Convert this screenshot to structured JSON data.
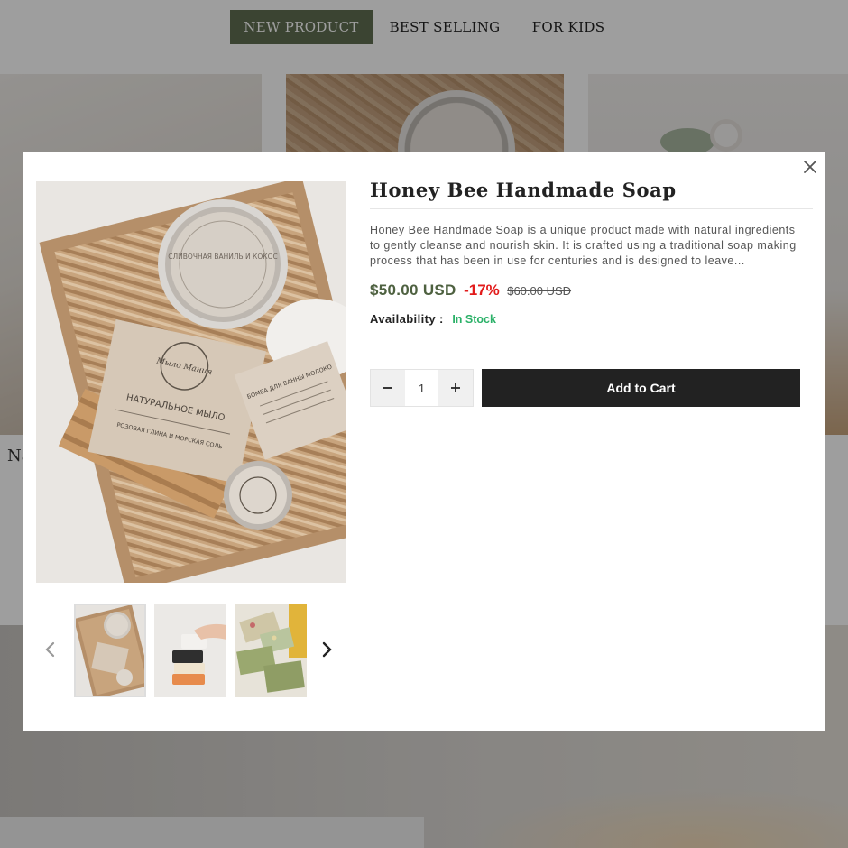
{
  "tabs": [
    {
      "label": "NEW PRODUCT",
      "active": true
    },
    {
      "label": "BEST SELLING",
      "active": false
    },
    {
      "label": "FOR KIDS",
      "active": false
    }
  ],
  "background": {
    "card_caption": "Na"
  },
  "modal": {
    "close_icon": "close-icon",
    "image_texts": {
      "tin_label": "СЛИВОЧНАЯ ВАНИЛЬ И КОКОС",
      "bar_brand": "Мыло Мания",
      "bar_title": "НАТУРАЛЬНОЕ МЫЛО",
      "bar_sub": "РОЗОВАЯ ГЛИНА И МОРСКАЯ СОЛЬ",
      "tag_title": "БОМБА ДЛЯ ВАННЫ МОЛОКО"
    },
    "thumbnails": [
      {
        "name": "gift-box"
      },
      {
        "name": "soap-stack"
      },
      {
        "name": "herbal-soap-bars"
      }
    ]
  },
  "product": {
    "title": "Honey Bee Handmade Soap",
    "description": "Honey Bee Handmade Soap is a unique product made with natural ingredients to gently cleanse and nourish skin. It is crafted using a traditional soap making process that has been in use for centuries and is designed to leave...",
    "price": "$50.00 USD",
    "discount": "-17%",
    "old_price": "$60.00 USD",
    "availability_label": "Availability :",
    "availability_value": "In Stock",
    "quantity": "1",
    "add_to_cart_label": "Add to Cart"
  },
  "colors": {
    "accent": "#5f6f52",
    "price": "#4e6140",
    "discount": "#e21b1b",
    "in_stock": "#2bb168",
    "button": "#222222"
  }
}
